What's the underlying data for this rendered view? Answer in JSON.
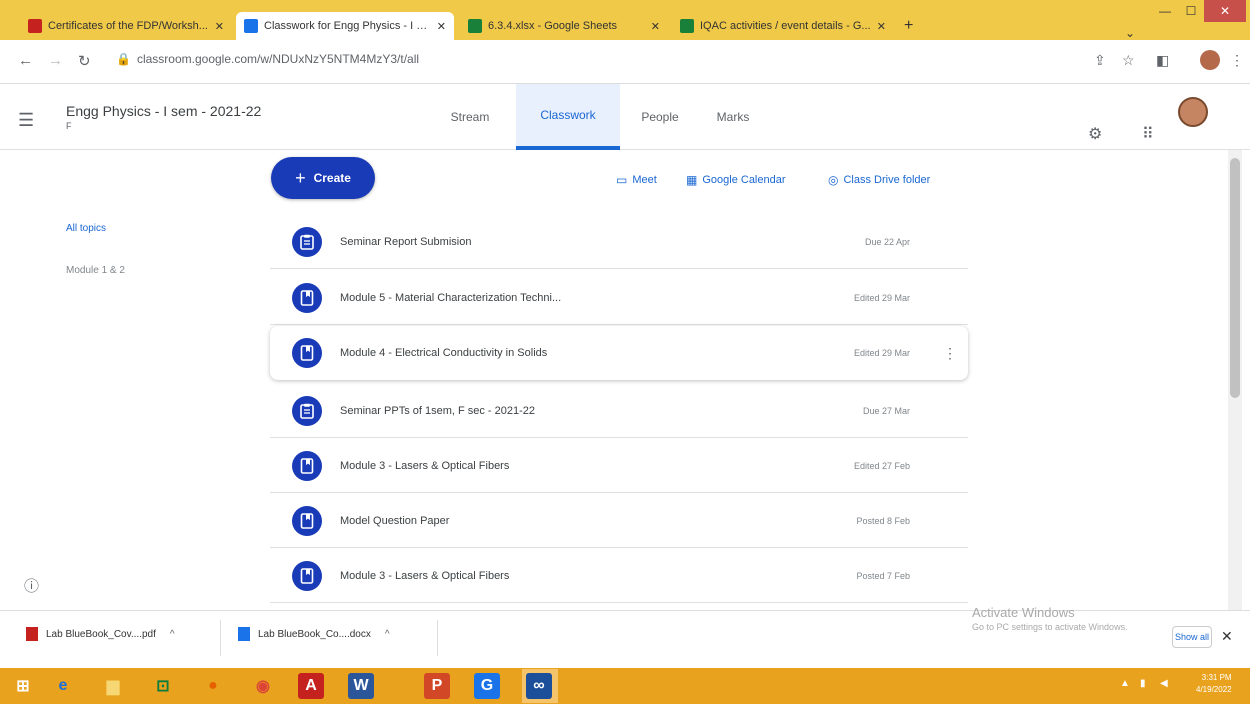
{
  "browser": {
    "tabs": [
      {
        "title": "Certificates of the FDP/Worksh...",
        "favicon_color": "#c5221f",
        "active": false
      },
      {
        "title": "Classwork for Engg Physics - I se...",
        "favicon_color": "#1a73e8",
        "active": true
      },
      {
        "title": "6.3.4.xlsx - Google Sheets",
        "favicon_color": "#188038",
        "active": false
      },
      {
        "title": "IQAC activities / event details - G...",
        "favicon_color": "#188038",
        "active": false
      }
    ],
    "new_tab": "+",
    "url": "classroom.google.com/w/NDUxNzY5NTM4MzY3/t/all"
  },
  "header": {
    "class_name": "Engg Physics - I sem - 2021-22",
    "section": "F",
    "tabs": [
      {
        "label": "Stream",
        "active": false
      },
      {
        "label": "Classwork",
        "active": true
      },
      {
        "label": "People",
        "active": false
      },
      {
        "label": "Marks",
        "active": false
      }
    ]
  },
  "toolbar": {
    "create_label": "Create",
    "links": [
      {
        "label": "Meet",
        "icon": "video-icon"
      },
      {
        "label": "Google Calendar",
        "icon": "calendar-icon"
      },
      {
        "label": "Class Drive folder",
        "icon": "drive-icon"
      }
    ]
  },
  "topics": [
    {
      "label": "All topics",
      "active": true
    },
    {
      "label": "Module 1 & 2",
      "active": false
    }
  ],
  "items": [
    {
      "title": "Seminar Report Submision",
      "date": "Due 22 Apr",
      "type": "assignment"
    },
    {
      "title": "Module 5 - Material Characterization Techni...",
      "date": "Edited 29 Mar",
      "type": "material"
    },
    {
      "title": "Module 4 - Electrical Conductivity in Solids",
      "date": "Edited 29 Mar",
      "type": "material"
    },
    {
      "title": "Seminar PPTs of 1sem, F sec - 2021-22",
      "date": "Due 27 Mar",
      "type": "assignment"
    },
    {
      "title": "Module 3 - Lasers & Optical Fibers",
      "date": "Edited 27 Feb",
      "type": "material"
    },
    {
      "title": "Model Question Paper",
      "date": "Posted 8 Feb",
      "type": "material"
    },
    {
      "title": "Module 3 - Lasers & Optical Fibers",
      "date": "Posted 7 Feb",
      "type": "material"
    }
  ],
  "downloads": {
    "files": [
      {
        "name": "Lab BlueBook_Cov....pdf",
        "icon_color": "#c5221f"
      },
      {
        "name": "Lab BlueBook_Co....docx",
        "icon_color": "#1a73e8"
      }
    ],
    "show_all": "Show all"
  },
  "watermark": {
    "line1": "Activate Windows",
    "line2": "Go to PC settings to activate Windows."
  },
  "taskbar": {
    "time": "3:31 PM",
    "date": "4/19/2022"
  },
  "colors": {
    "accent": "#1967d2",
    "create_button": "#1a3bb8",
    "tabstrip": "#f1c948",
    "taskbar": "#e8a21d"
  }
}
